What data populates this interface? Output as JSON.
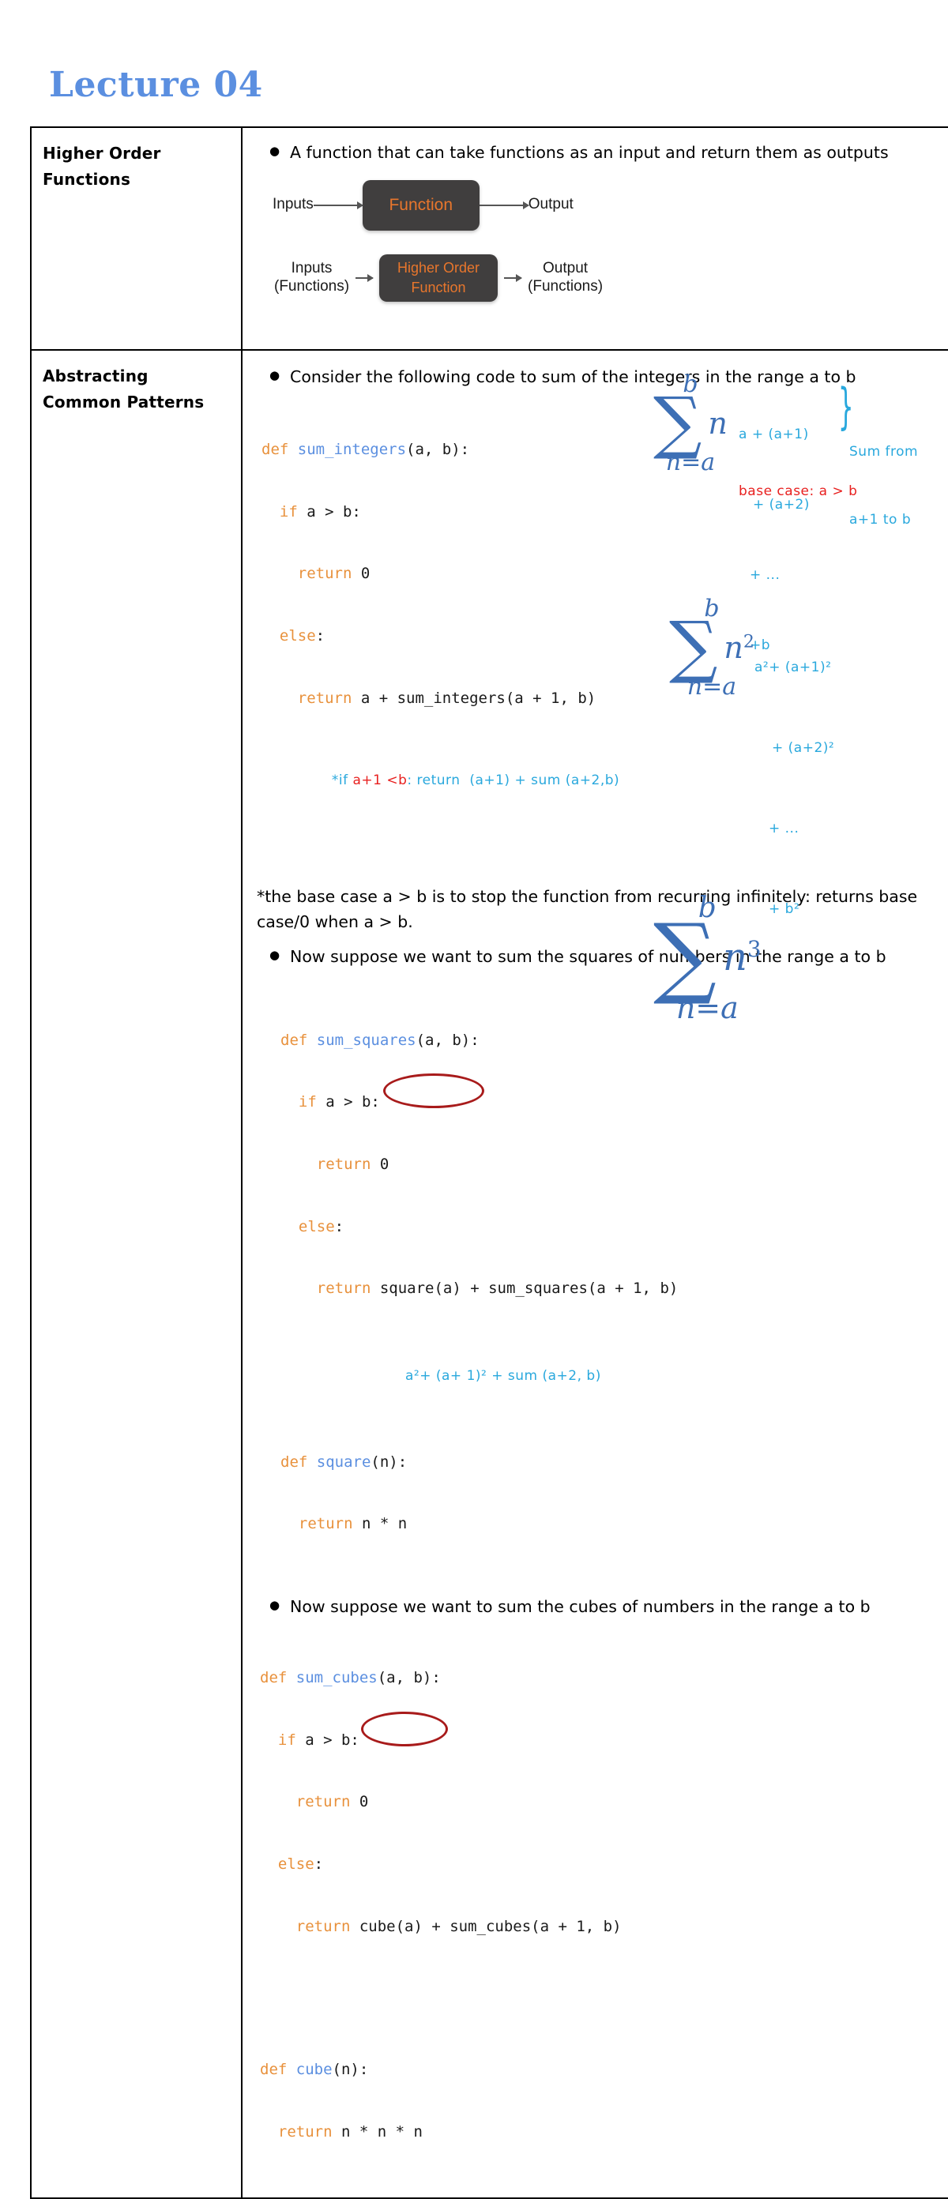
{
  "title": "Lecture 04",
  "accent_colors": {
    "title_blue": "#5b8fe0",
    "code_keyword_orange": "#e8913c",
    "code_function_blue": "#5b8fe0",
    "diagram_box_dark": "#403e3e",
    "diagram_text_orange": "#e8762c",
    "handwriting_cyan": "#29a8dd",
    "handwriting_red": "#e8201f",
    "ellipse_red": "#a81b1b",
    "sigma_blue": "#3d6fb5"
  },
  "rows": [
    {
      "label": "Higher Order Functions",
      "bullets": [
        "A function that can take functions as an input and return them as outputs"
      ],
      "diagrams": [
        {
          "input_label": "Inputs",
          "box_lines": [
            "Function"
          ],
          "output_label": "Output"
        },
        {
          "input_label": "Inputs",
          "input_sublabel": "(Functions)",
          "box_lines": [
            "Higher Order",
            "Function"
          ],
          "output_label": "Output",
          "output_sublabel": "(Functions)"
        }
      ]
    },
    {
      "label": "Abstracting Common Patterns",
      "bullets": [
        "Consider the following code to sum of the integers in the range a to  b",
        "Now suppose we want to sum the squares of numbers in the range a to b",
        "Now suppose we want to sum the cubes of numbers in the range a to b"
      ],
      "note_paragraph": "*the base case a > b is to stop the function from recurring infinitely: returns base case/0 when a > b.",
      "code_blocks": [
        {
          "name": "sum_integers",
          "lines": [
            [
              {
                "t": "def ",
                "c": "kw"
              },
              {
                "t": "sum_integers",
                "c": "fn"
              },
              {
                "t": "(a, b):",
                "c": "num"
              }
            ],
            [
              {
                "t": "  if",
                "c": "kw"
              },
              {
                "t": " a > b:",
                "c": "num"
              }
            ],
            [
              {
                "t": "    return",
                "c": "kw"
              },
              {
                "t": " 0",
                "c": "num"
              }
            ],
            [
              {
                "t": "  else",
                "c": "kw"
              },
              {
                "t": ":",
                "c": "num"
              }
            ],
            [
              {
                "t": "    return",
                "c": "kw"
              },
              {
                "t": " a + sum_integers(a + 1, b)",
                "c": "num"
              }
            ]
          ]
        },
        {
          "name": "sum_squares",
          "lines": [
            [
              {
                "t": "def ",
                "c": "kw"
              },
              {
                "t": "sum_squares",
                "c": "fn"
              },
              {
                "t": "(a, b):",
                "c": "num"
              }
            ],
            [
              {
                "t": "  if",
                "c": "kw"
              },
              {
                "t": " a > b:",
                "c": "num"
              }
            ],
            [
              {
                "t": "    return",
                "c": "kw"
              },
              {
                "t": " 0",
                "c": "num"
              }
            ],
            [
              {
                "t": "  else",
                "c": "kw"
              },
              {
                "t": ":",
                "c": "num"
              }
            ],
            [
              {
                "t": "    return",
                "c": "kw"
              },
              {
                "t": " square(a) + sum_squares(a + 1, b)",
                "c": "num"
              }
            ]
          ]
        },
        {
          "name": "square",
          "lines": [
            [
              {
                "t": "def ",
                "c": "kw"
              },
              {
                "t": "square",
                "c": "fn"
              },
              {
                "t": "(n):",
                "c": "num"
              }
            ],
            [
              {
                "t": "  return",
                "c": "kw"
              },
              {
                "t": " n * n",
                "c": "num"
              }
            ]
          ]
        },
        {
          "name": "sum_cubes",
          "lines": [
            [
              {
                "t": "def ",
                "c": "kw"
              },
              {
                "t": "sum_cubes",
                "c": "fn"
              },
              {
                "t": "(a, b):",
                "c": "num"
              }
            ],
            [
              {
                "t": "  if",
                "c": "kw"
              },
              {
                "t": " a > b:",
                "c": "num"
              }
            ],
            [
              {
                "t": "    return",
                "c": "kw"
              },
              {
                "t": " 0",
                "c": "num"
              }
            ],
            [
              {
                "t": "  else",
                "c": "kw"
              },
              {
                "t": ":",
                "c": "num"
              }
            ],
            [
              {
                "t": "    return",
                "c": "kw"
              },
              {
                "t": " cube(a) + sum_cubes(a + 1, b)",
                "c": "num"
              }
            ]
          ]
        },
        {
          "name": "cube",
          "lines": [
            [
              {
                "t": "def ",
                "c": "kw"
              },
              {
                "t": "cube",
                "c": "fn"
              },
              {
                "t": "(n):",
                "c": "num"
              }
            ],
            [
              {
                "t": "  return",
                "c": "kw"
              },
              {
                "t": " n * n * n",
                "c": "num"
              }
            ]
          ]
        }
      ],
      "annotations": {
        "integers_handwritten_prefix": "*if ",
        "integers_handwritten_red": "a+1 <b",
        "integers_handwritten_rest": ": return  (a+1) + sum (a+2,b)",
        "squares_handwritten": "a²+ (a+ 1)² + sum (a+2, b)"
      },
      "summations": [
        {
          "upper": "b",
          "lower": "n=a",
          "term": "n",
          "exponent": "",
          "expansion": [
            "a + (a+1)",
            "+ (a+2)",
            "+ ...",
            "+b"
          ],
          "brace_note": [
            "Sum from",
            "a+1 to b"
          ],
          "base_case_note": "base case: a > b"
        },
        {
          "upper": "b",
          "lower": "n=a",
          "term": "n",
          "exponent": "2",
          "expansion": [
            "a²+ (a+1)²",
            "+ (a+2)²",
            "+ ...",
            "+ b²"
          ]
        },
        {
          "upper": "b",
          "lower": "n=a",
          "term": "n",
          "exponent": "3",
          "expansion": []
        }
      ]
    }
  ]
}
